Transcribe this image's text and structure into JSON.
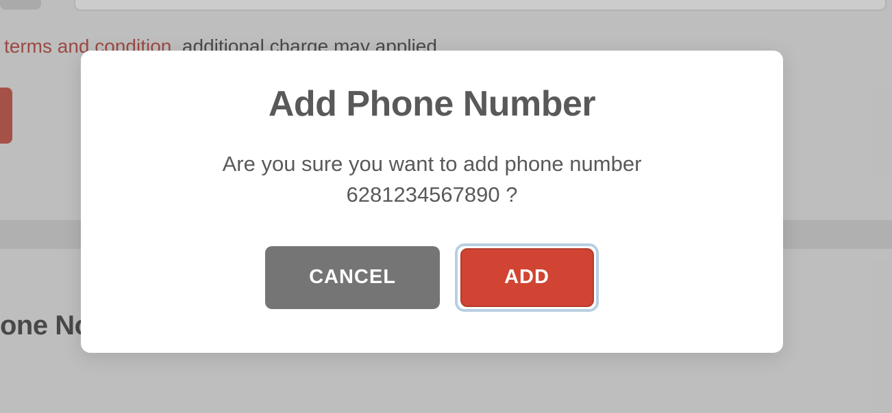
{
  "background": {
    "terms_link": "terms and condition",
    "terms_tail": ", additional charge may applied.",
    "one_no_label": "one No"
  },
  "modal": {
    "title": "Add Phone Number",
    "message_line1": "Are you sure you want to add phone number",
    "message_line2": "6281234567890 ?",
    "cancel_label": "CANCEL",
    "add_label": "ADD"
  }
}
